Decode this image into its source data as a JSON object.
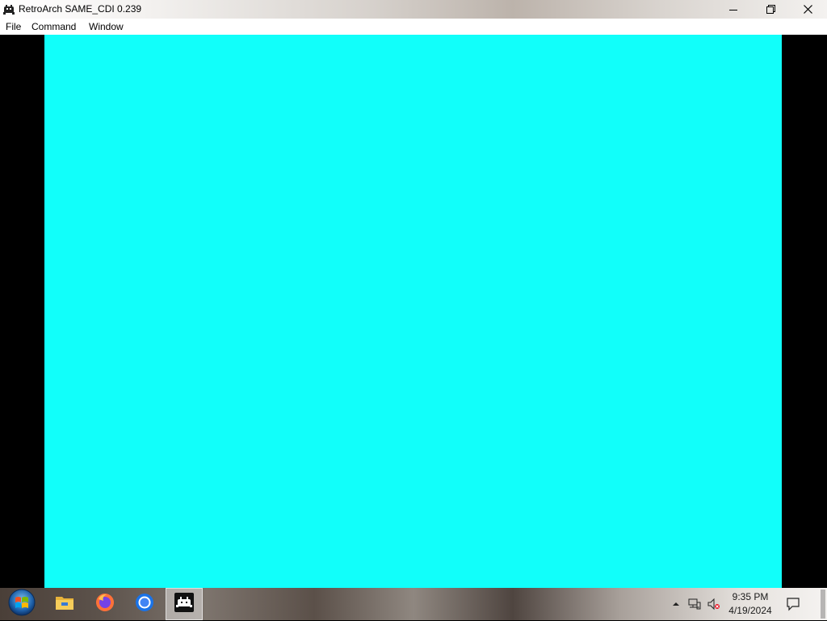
{
  "window": {
    "title": "RetroArch SAME_CDI 0.239",
    "app_icon": "retroarch-icon",
    "controls": [
      "minimize-icon",
      "restore-icon",
      "close-icon"
    ]
  },
  "menu": {
    "items": [
      {
        "label": "File"
      },
      {
        "label": "Command"
      },
      {
        "label": "Window"
      }
    ]
  },
  "content": {
    "screen_color": "#11FFFA",
    "letterbox_color": "#000000"
  },
  "taskbar": {
    "start_icon": "windows-start-icon",
    "pinned": [
      "file-explorer-icon",
      "firefox-icon",
      "chrome-icon",
      "retroarch-icon"
    ],
    "active_app": "retroarch-icon",
    "tray": {
      "icons": [
        "show-hidden-icons-chevron",
        "network-icon",
        "volume-muted-icon",
        "action-center-icon"
      ],
      "time": "9:35 PM",
      "date": "4/19/2024"
    }
  }
}
